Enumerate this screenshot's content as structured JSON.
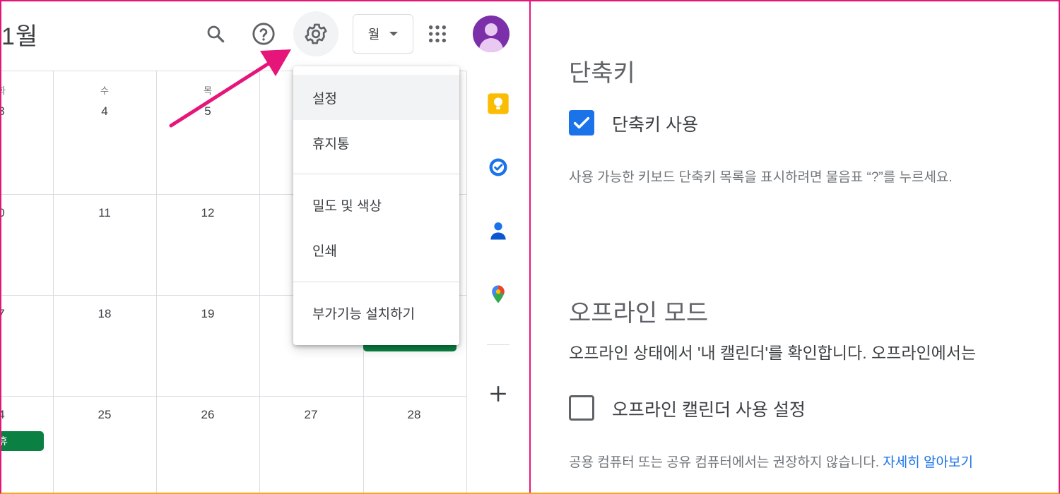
{
  "header": {
    "month_title": "1월",
    "view_select": "월"
  },
  "calendar": {
    "weekdays": [
      "화",
      "수",
      "목"
    ],
    "rows": [
      [
        "3",
        "4",
        "5"
      ],
      [
        "0",
        "11",
        "12"
      ],
      [
        "7",
        "18",
        "19"
      ],
      [
        "4",
        "25",
        "26",
        "27",
        "28"
      ]
    ],
    "event_label": "휴"
  },
  "menu": {
    "items": [
      "설정",
      "휴지통",
      "밀도 및 색상",
      "인쇄",
      "부가기능 설치하기"
    ]
  },
  "shortcuts": {
    "title": "단축키",
    "checkbox_label": "단축키 사용",
    "checked": true,
    "description": "사용 가능한 키보드 단축키 목록을 표시하려면 물음표 “?”를 누르세요."
  },
  "offline": {
    "title": "오프라인 모드",
    "description": "오프라인 상태에서 '내 캘린더'를 확인합니다. 오프라인에서는",
    "checkbox_label": "오프라인 캘린더 사용 설정",
    "checked": false,
    "note": "공용 컴퓨터 또는 공유 컴퓨터에서는 권장하지 않습니다.",
    "learn_more": "자세히 알아보기"
  },
  "colors": {
    "accent": "#1a73e8",
    "event_green": "#0b8043",
    "arrow": "#e6157a",
    "avatar": "#7b2fa8"
  }
}
